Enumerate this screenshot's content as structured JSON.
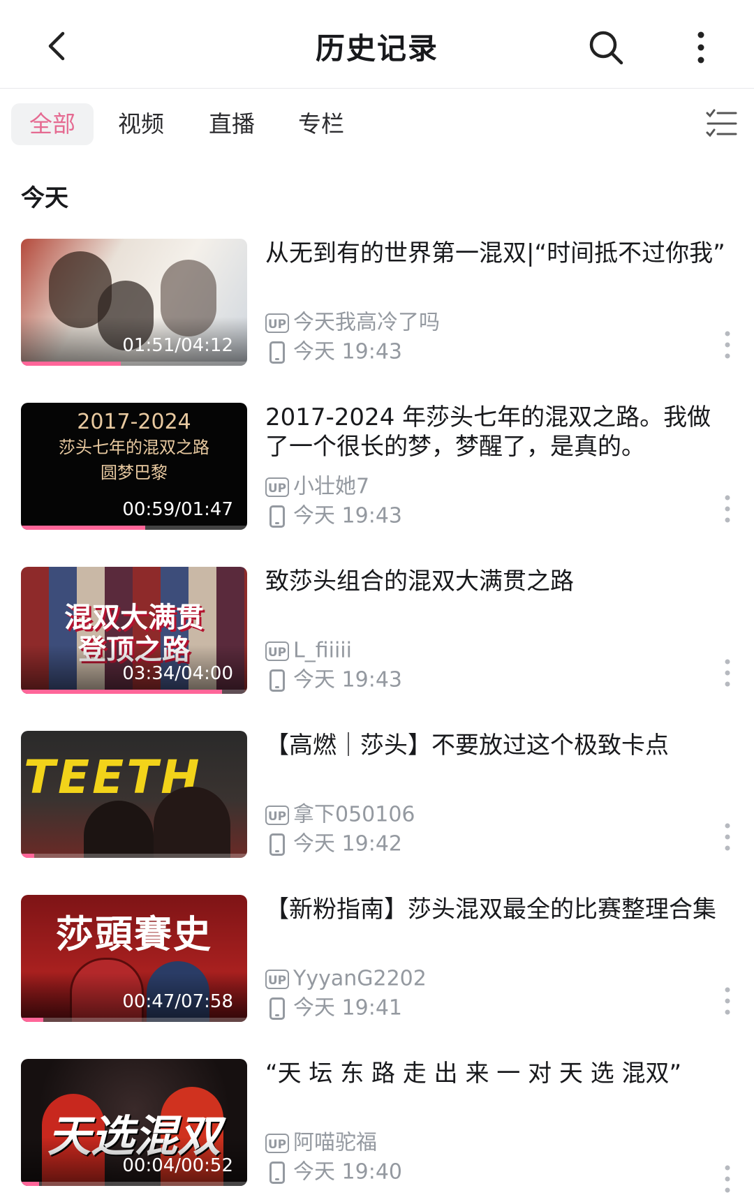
{
  "header": {
    "title": "历史记录",
    "icons": [
      "back-arrow-icon",
      "search-icon",
      "more-vertical-icon"
    ]
  },
  "tabs": [
    {
      "label": "全部",
      "active": true
    },
    {
      "label": "视频",
      "active": false
    },
    {
      "label": "直播",
      "active": false
    },
    {
      "label": "专栏",
      "active": false
    }
  ],
  "filter_icon": "list-filter-icon",
  "section_title": "今天",
  "accent_color": "#ff6699",
  "items": [
    {
      "title": "从无到有的世界第一混双|“时间抵不过你我”",
      "uploader": "今天我高冷了吗",
      "time": "今天 19:43",
      "duration": "01:51/04:12",
      "progress": 0.44
    },
    {
      "title": "2017-2024 年莎头七年的混双之路。我做了一个很长的梦，梦醒了，是真的。",
      "uploader": "小壮她7",
      "time": "今天 19:43",
      "duration": "00:59/01:47",
      "progress": 0.55,
      "thumb_text": [
        "2017-2024",
        "莎头七年的混双之路",
        "圆梦巴黎"
      ]
    },
    {
      "title": "致莎头组合的混双大满贯之路",
      "uploader": "L_fiiiii",
      "time": "今天 19:43",
      "duration": "03:34/04:00",
      "progress": 0.89,
      "thumb_text": [
        "混双大满贯",
        "登顶之路"
      ]
    },
    {
      "title": "【高燃｜莎头】不要放过这个极致卡点",
      "uploader": "拿下050106",
      "time": "今天 19:42",
      "duration": "",
      "progress": 0.06,
      "thumb_text": [
        "TEETH"
      ]
    },
    {
      "title": "【新粉指南】莎头混双最全的比赛整理合集",
      "uploader": "YyyanG2202",
      "time": "今天 19:41",
      "duration": "00:47/07:58",
      "progress": 0.1,
      "thumb_text": [
        "莎頭賽史"
      ]
    },
    {
      "title": "“天 坛 东 路 走 出 来 一 对 天 选 混双”",
      "uploader": "阿喵驼福",
      "time": "今天 19:40",
      "duration": "00:04/00:52",
      "progress": 0.08,
      "thumb_text": [
        "天选混双"
      ]
    }
  ]
}
